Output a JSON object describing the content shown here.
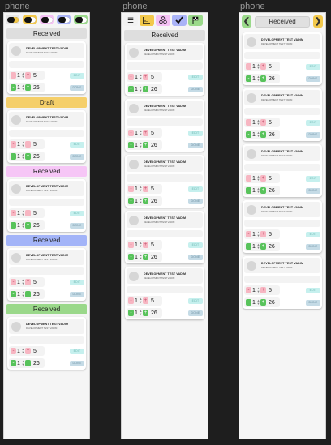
{
  "frames": [
    {
      "label": "phone"
    },
    {
      "label": "phone"
    },
    {
      "label": "phone"
    }
  ],
  "phone1": {
    "toggles": [
      {
        "color": "#e6e6e6",
        "knob": "#f2c84b"
      },
      {
        "color": "#f2c84b",
        "knob": "#ffffff"
      },
      {
        "color": "#f5c1f5",
        "knob": "#ffffff"
      },
      {
        "color": "#a9b3f7",
        "knob": "#ffffff"
      },
      {
        "color": "#9ad98a",
        "knob": "#ffffff"
      }
    ],
    "sections": [
      {
        "title": "Received",
        "color": "#dedede"
      },
      {
        "title": "Draft",
        "color": "#f5cf6a"
      },
      {
        "title": "Received",
        "color": "#f6c6f6"
      },
      {
        "title": "Received",
        "color": "#a3b4f8"
      },
      {
        "title": "Received",
        "color": "#9ad88a"
      }
    ]
  },
  "phone2": {
    "icons": [
      {
        "name": "list-icon",
        "glyph": "☰",
        "color": "#f2f2f2"
      },
      {
        "name": "ruler-icon",
        "glyph": "📐",
        "color": "#f2c84b"
      },
      {
        "name": "nodes-icon",
        "glyph": "✣",
        "color": "#f5c1f5"
      },
      {
        "name": "check-icon",
        "glyph": "✔",
        "color": "#a9b3f7"
      },
      {
        "name": "flag-icon",
        "glyph": "⚑",
        "color": "#9ad98a"
      }
    ],
    "title": "Received"
  },
  "phone3": {
    "prev_arrow": "❮",
    "next_arrow": "❯",
    "title": "Received"
  },
  "card": {
    "title": "DEVELOPMENT TEST VADIM",
    "subtitle": "DEVELOPMENT TEST VADIM",
    "qty_a": "1",
    "total_a": "5",
    "qty_b": "1",
    "total_b": "26",
    "minus": "-",
    "plus": "+",
    "edit": "EDIT",
    "done": "DONE"
  }
}
